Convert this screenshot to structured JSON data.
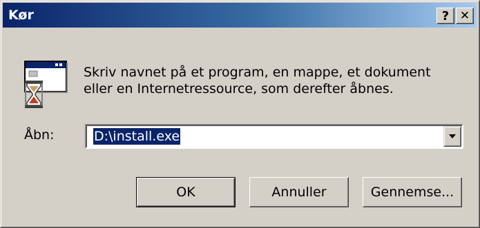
{
  "window": {
    "title": "Kør",
    "help_label": "?",
    "close_label": "✕"
  },
  "icon": "run-program-icon",
  "prompt": {
    "line1": "Skriv navnet på et program, en mappe, et dokument",
    "line2": "eller en Internetressource, som derefter åbnes."
  },
  "open": {
    "label": "Åbn:",
    "value": "D:\\install.exe"
  },
  "buttons": {
    "ok": "OK",
    "cancel": "Annuller",
    "browse": "Gennemse..."
  },
  "colors": {
    "title_start": "#0a246a",
    "title_end": "#a6caf0",
    "face": "#d4d0c8",
    "selection": "#0a246a"
  }
}
